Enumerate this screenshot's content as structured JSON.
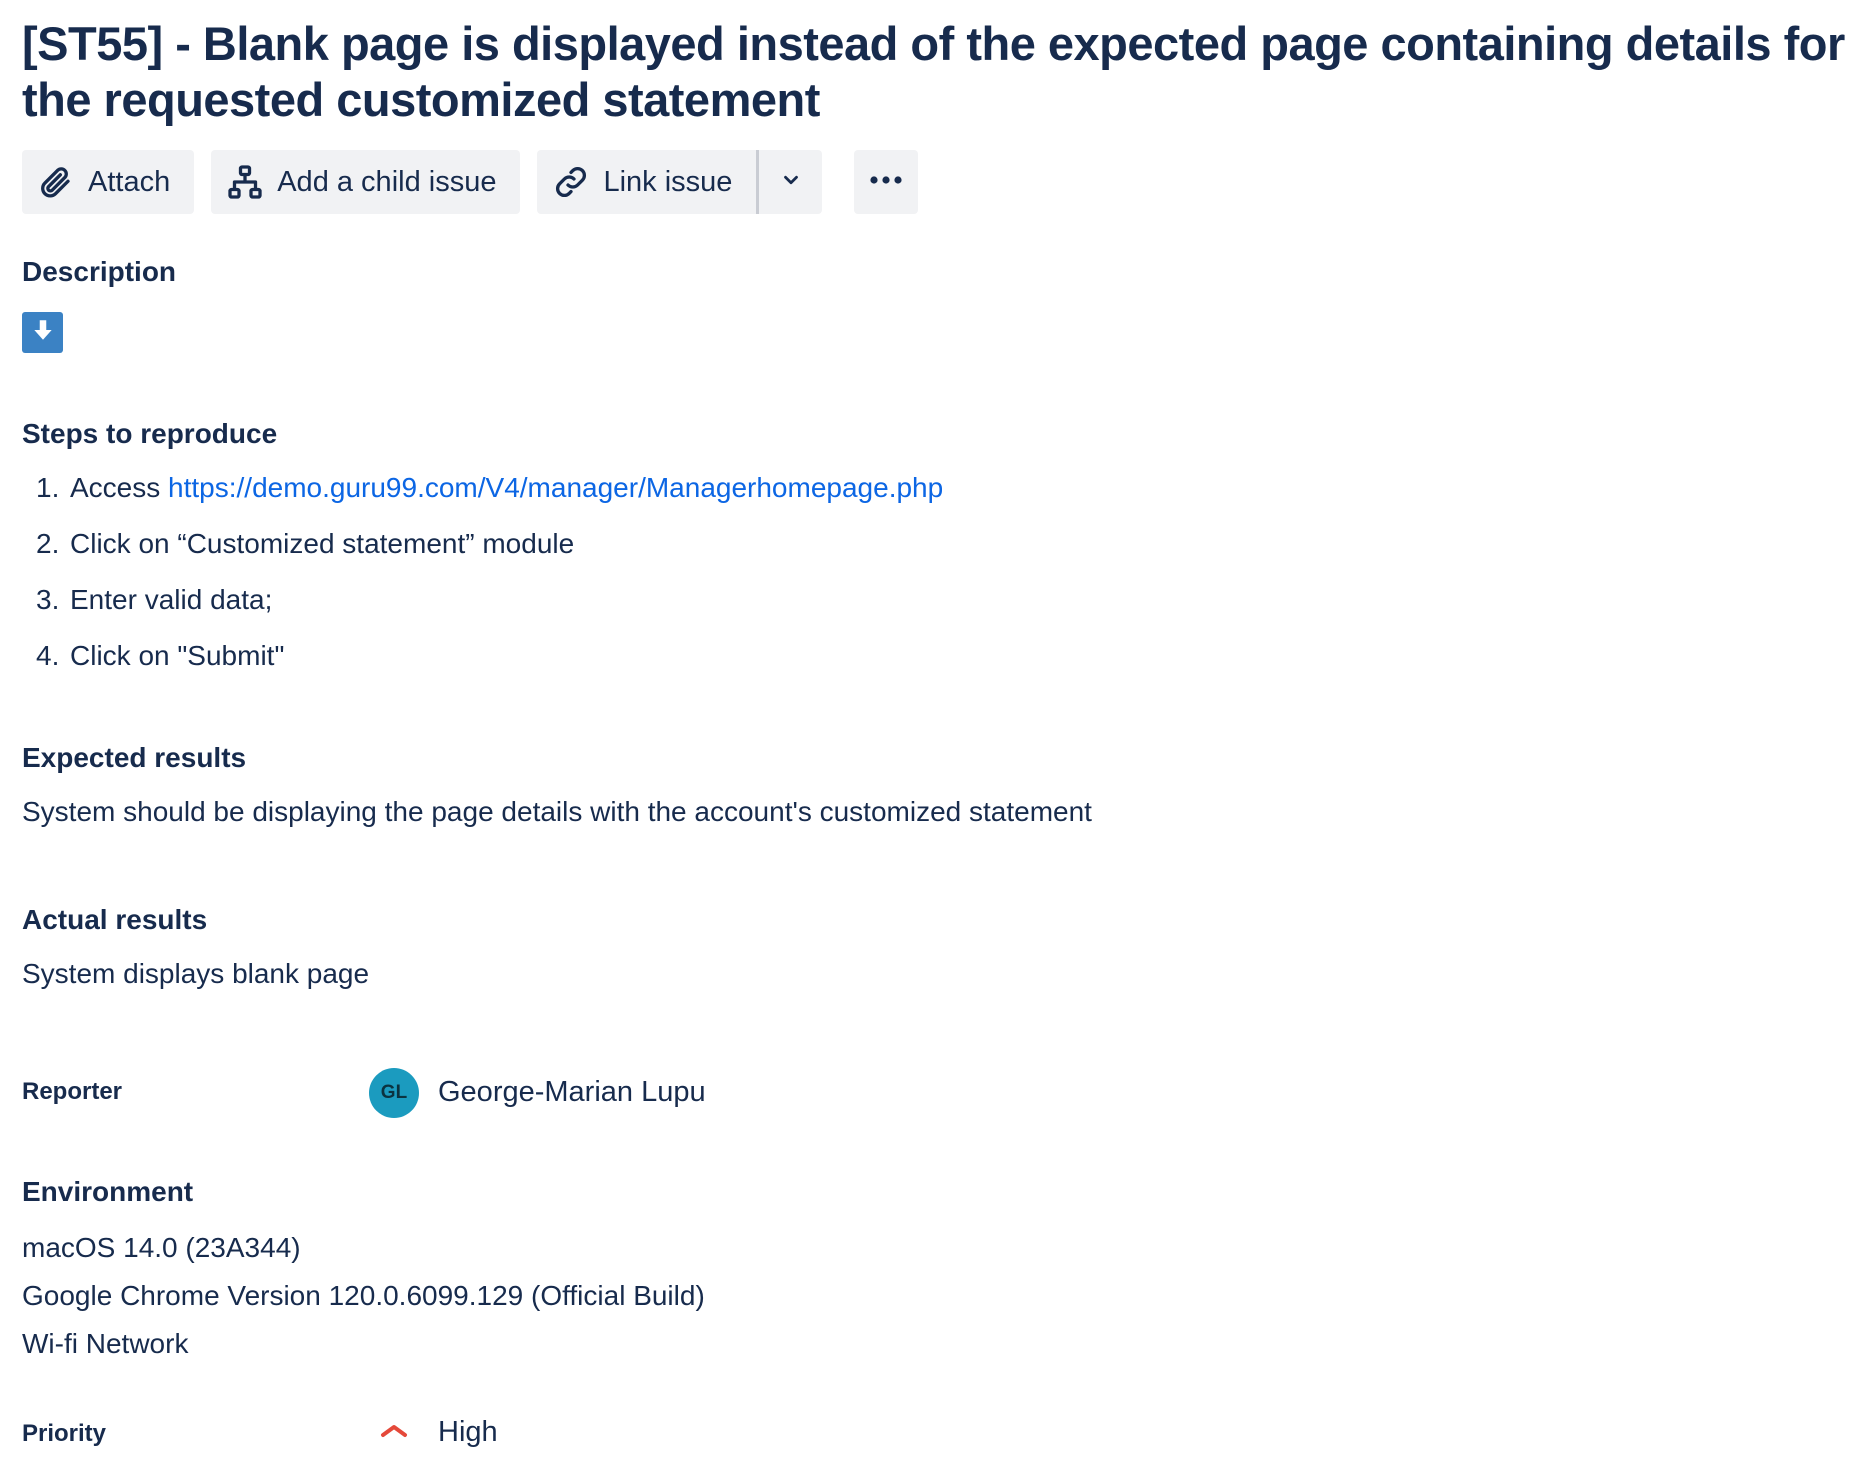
{
  "issue": {
    "title": "[ST55] - Blank page is displayed instead of the expected page containing details for the requested customized statement"
  },
  "toolbar": {
    "attach_label": "Attach",
    "add_child_label": "Add a child issue",
    "link_issue_label": "Link issue"
  },
  "description": {
    "heading": "Description"
  },
  "steps": {
    "heading": "Steps to reproduce",
    "items": [
      {
        "num": "1.",
        "prefix": "Access ",
        "link": "https://demo.guru99.com/V4/manager/Managerhomepage.php"
      },
      {
        "num": "2.",
        "text": "Click on “Customized statement” module"
      },
      {
        "num": "3.",
        "text": "Enter valid data;"
      },
      {
        "num": "4.",
        "text": "Click on \"Submit\""
      }
    ]
  },
  "expected": {
    "heading": "Expected results",
    "text": "System should be displaying the page details with the account's customized statement"
  },
  "actual": {
    "heading": "Actual results",
    "text": "System displays blank page"
  },
  "reporter": {
    "label": "Reporter",
    "initials": "GL",
    "name": "George-Marian Lupu",
    "avatar_color": "#1b9bbf"
  },
  "environment": {
    "heading": "Environment",
    "lines": [
      "macOS 14.0 (23A344)",
      "Google Chrome Version 120.0.6099.129 (Official Build)",
      "Wi-fi Network"
    ]
  },
  "priority": {
    "label": "Priority",
    "value": "High",
    "icon": "priority-high-icon",
    "color": "#e5493a"
  },
  "colors": {
    "text": "#172b4d",
    "link": "#0c66e4",
    "button_bg": "#f1f2f4",
    "expand_button": "#3b82c4"
  }
}
